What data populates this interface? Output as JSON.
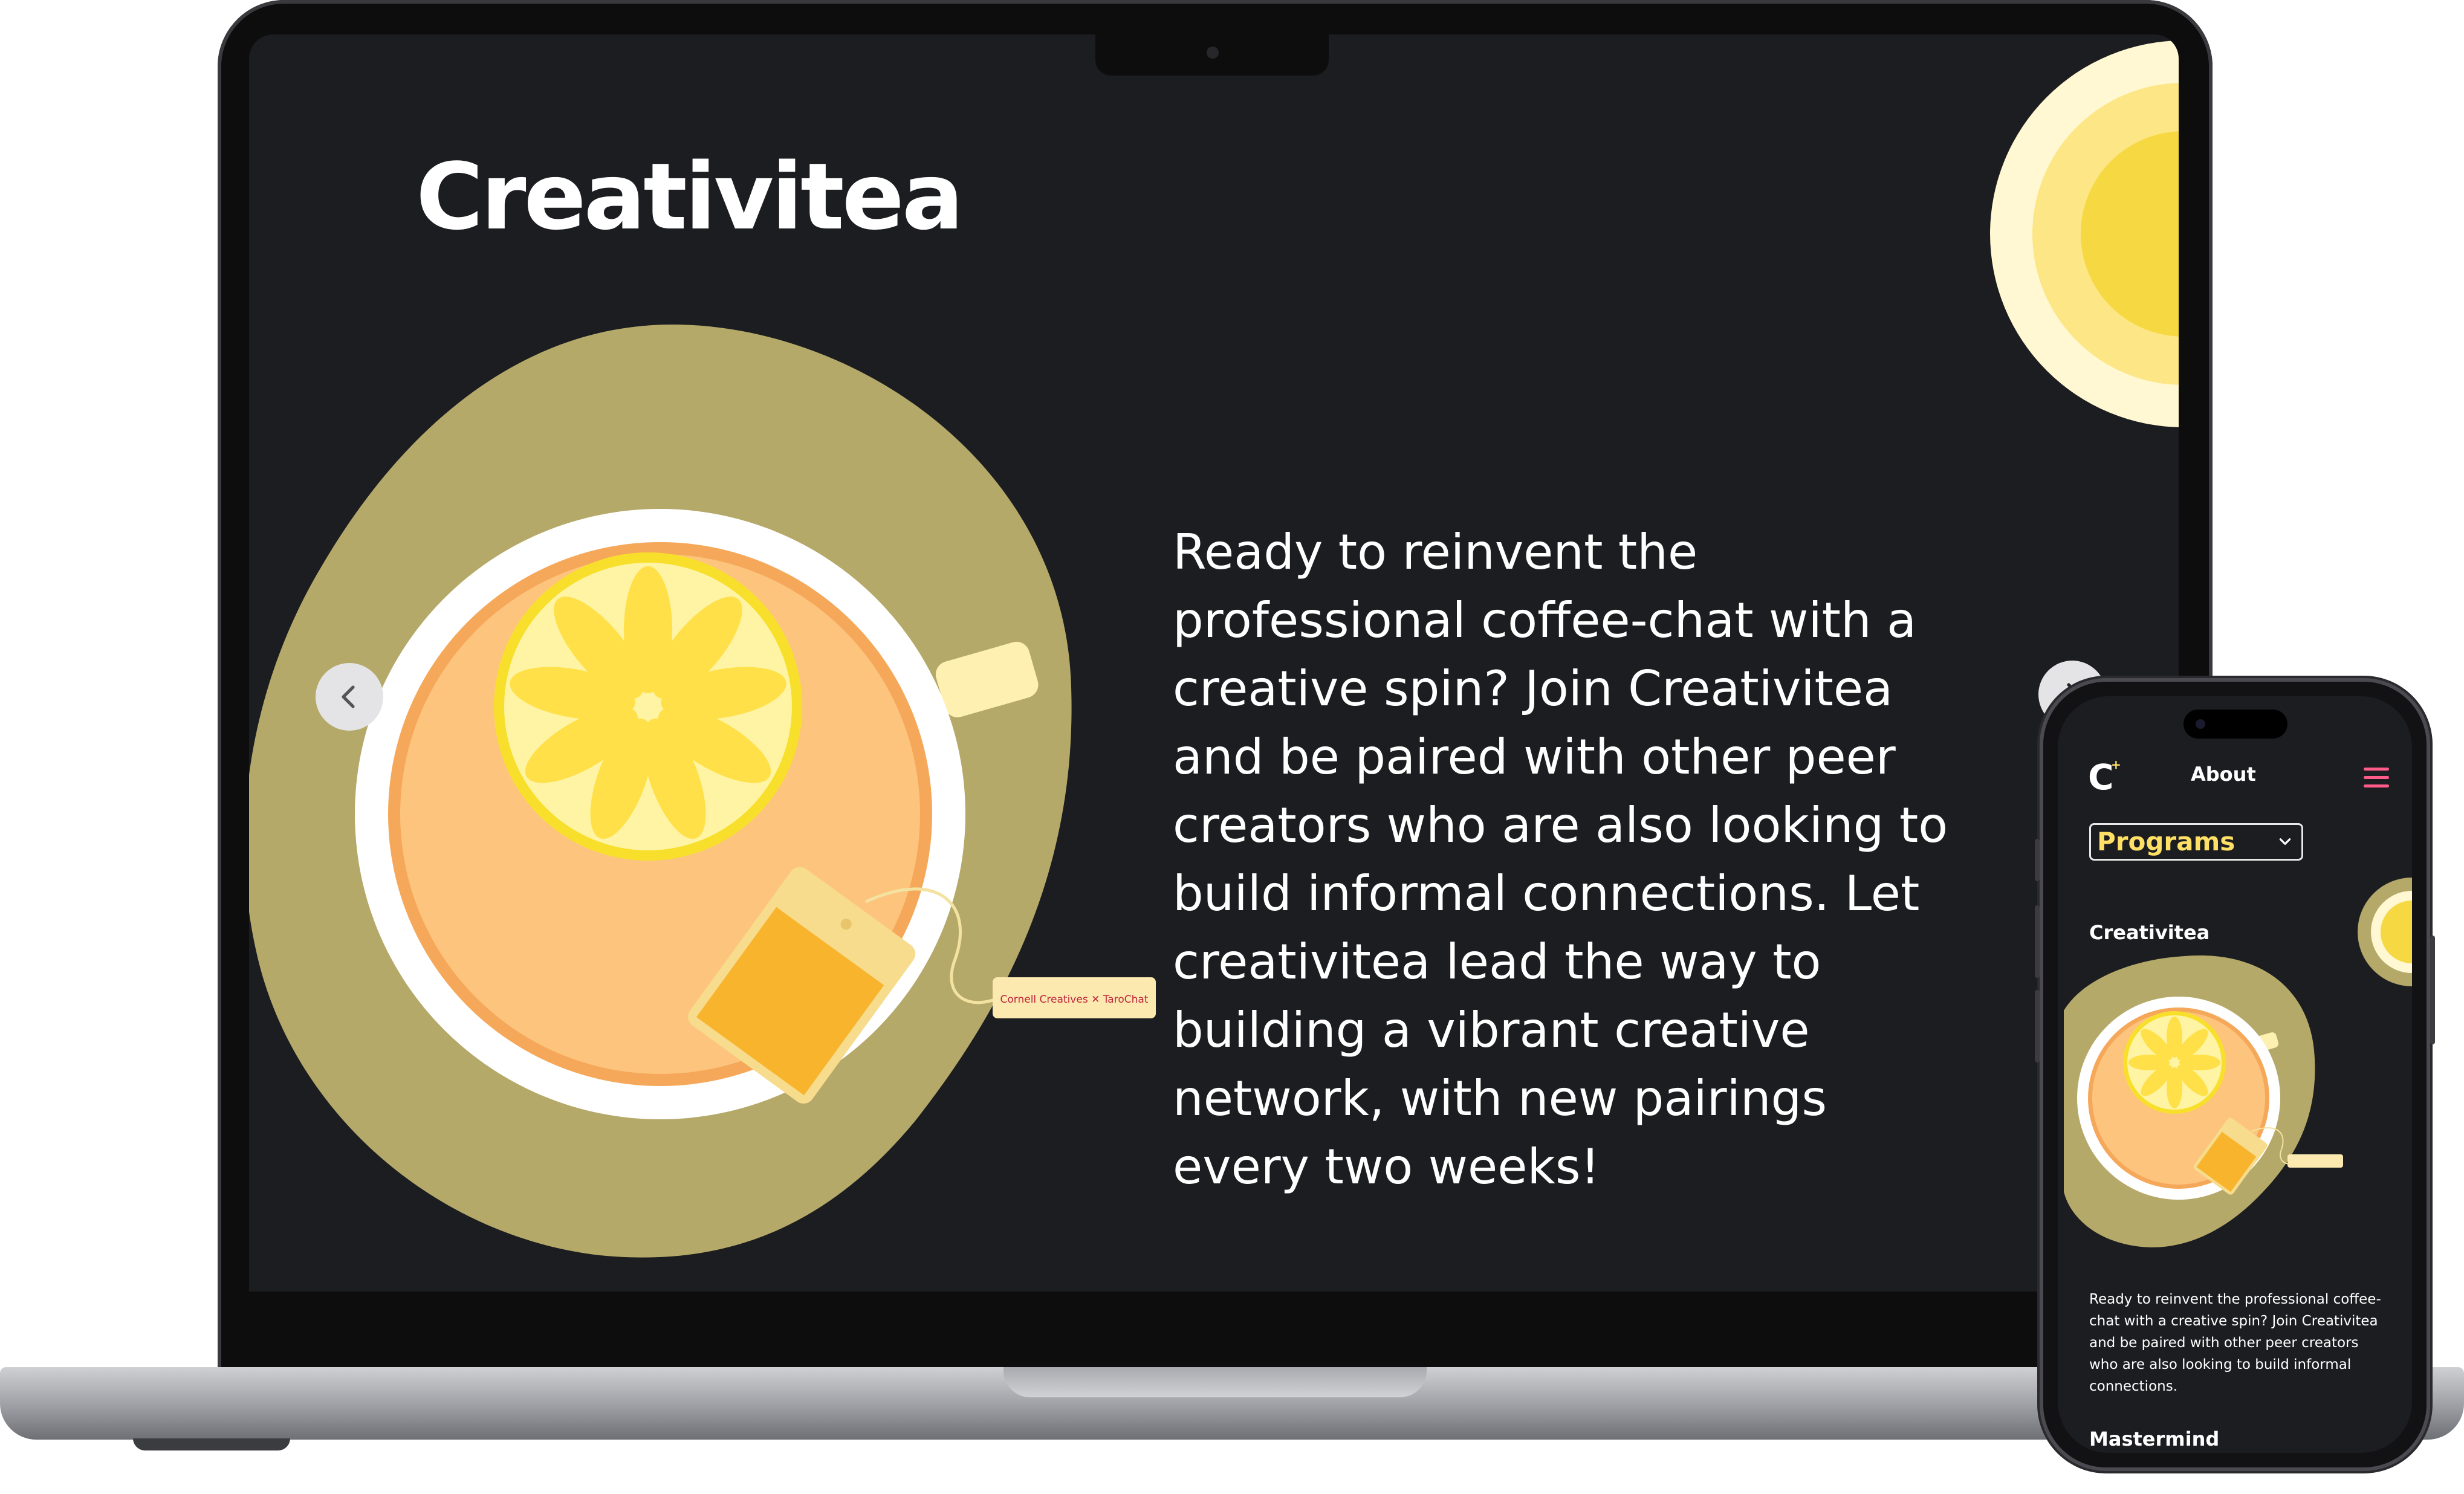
{
  "desktop": {
    "title": "Creativitea",
    "description": "Ready to reinvent the professional coffee-chat with a creative spin? Join Creativitea and be paired with other peer creators who are also looking to build informal connections. Let creativitea lead the way to building a vibrant creative network, with new pairings every two weeks!",
    "tea_tag_label": "Cornell Creatives ✕ TaroChat",
    "prev_icon": "chevron-left-icon",
    "next_icon": "chevron-right-icon"
  },
  "mobile": {
    "nav_about": "About",
    "logo_letter": "C",
    "dropdown_value": "Programs",
    "section_title": "Creativitea",
    "description": "Ready to reinvent the professional coffee-chat with a creative spin? Join Creativitea and be paired with other peer creators who are also looking to build informal connections.",
    "next_section_title": "Mastermind",
    "menu_icon": "hamburger-menu-icon"
  },
  "colors": {
    "background": "#1c1d20",
    "olive": "#b5a96a",
    "lemon": "#ffe066",
    "tea": "#fdc47e",
    "accent_menu": "#ff5c8a"
  }
}
